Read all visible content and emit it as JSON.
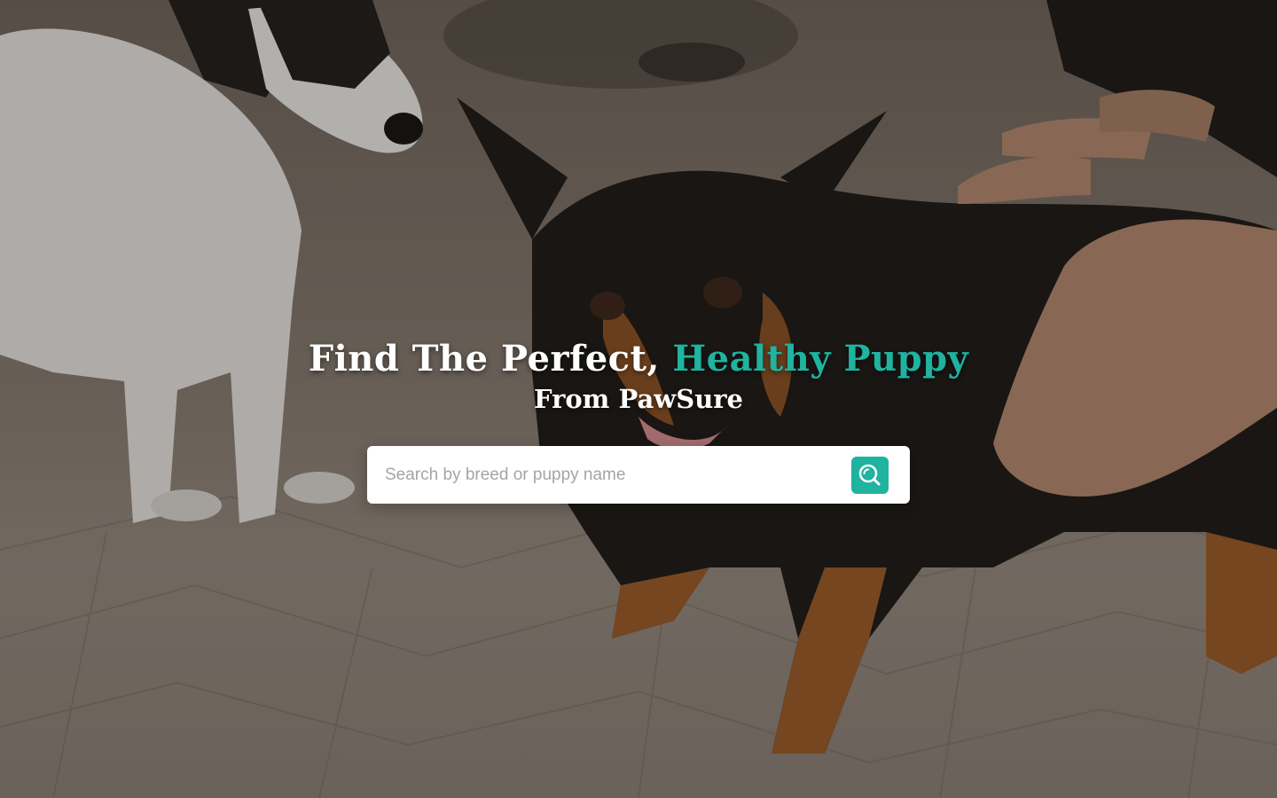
{
  "hero": {
    "headline_main": "Find The Perfect, ",
    "headline_accent": "Healthy Puppy",
    "subheadline": "From PawSure"
  },
  "search": {
    "placeholder": "Search by breed or puppy name",
    "value": "",
    "button_icon": "search-icon"
  },
  "colors": {
    "accent": "#1fb3a0",
    "text_light": "#ffffff",
    "placeholder": "#a5a5a5"
  }
}
